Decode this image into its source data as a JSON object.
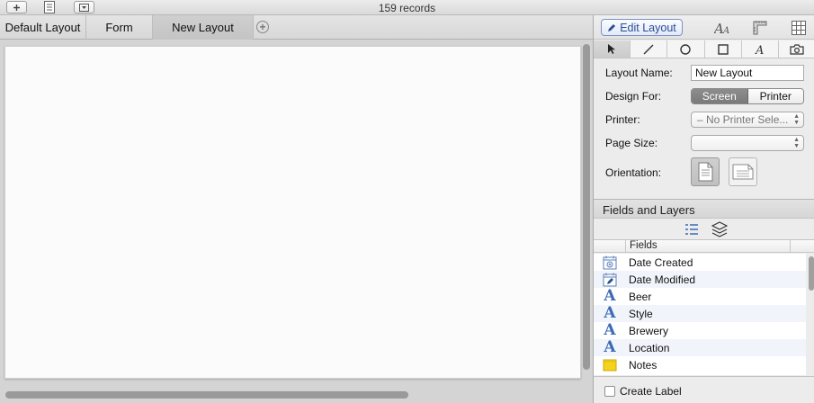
{
  "toolbar": {
    "record_count": "159 records",
    "add_icon": "plus-icon",
    "list_icon": "list-view-icon",
    "menu_icon": "dropdown-menu-icon"
  },
  "layout_tabs": [
    {
      "label": "Default Layout",
      "active": false
    },
    {
      "label": "Form",
      "active": false
    },
    {
      "label": "New Layout",
      "active": true
    }
  ],
  "inspector": {
    "edit_layout_label": "Edit Layout",
    "layout_name_label": "Layout Name:",
    "layout_name_value": "New Layout",
    "design_for_label": "Design For:",
    "design_for_options": [
      "Screen",
      "Printer"
    ],
    "design_for_selected": "Screen",
    "printer_label": "Printer:",
    "printer_value": "– No Printer Sele...",
    "page_size_label": "Page Size:",
    "page_size_value": "",
    "orientation_label": "Orientation:",
    "orientation_selected": "portrait"
  },
  "fields_and_layers": {
    "title": "Fields and Layers",
    "column_header": "Fields",
    "fields": [
      {
        "name": "Date Created",
        "icon": "date-created-icon"
      },
      {
        "name": "Date Modified",
        "icon": "date-modified-icon"
      },
      {
        "name": "Beer",
        "icon": "text-field-icon"
      },
      {
        "name": "Style",
        "icon": "text-field-icon"
      },
      {
        "name": "Brewery",
        "icon": "text-field-icon"
      },
      {
        "name": "Location",
        "icon": "text-field-icon"
      },
      {
        "name": "Notes",
        "icon": "note-field-icon"
      }
    ],
    "create_label": "Create Label",
    "create_label_checked": false
  },
  "colors": {
    "accent_blue": "#3a6bb4",
    "selected_segment": "#7f7f7f",
    "note_yellow": "#f5d21c"
  }
}
